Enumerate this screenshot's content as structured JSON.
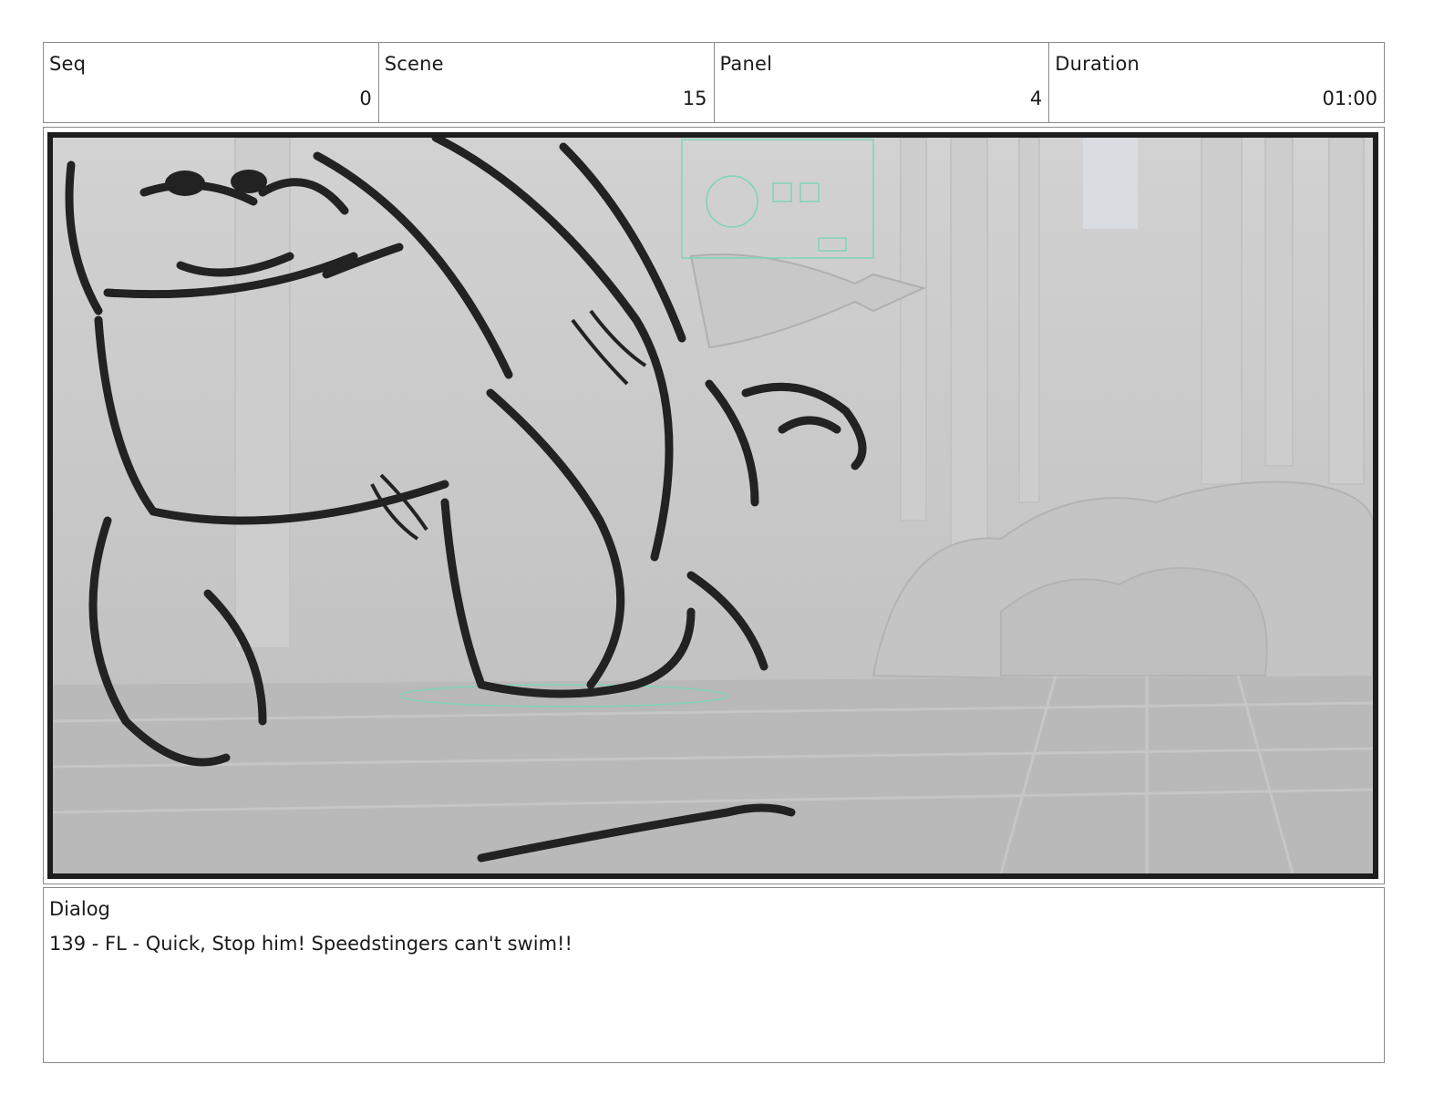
{
  "header": {
    "seq": {
      "label": "Seq",
      "value": "0"
    },
    "scene": {
      "label": "Scene",
      "value": "15"
    },
    "panel": {
      "label": "Panel",
      "value": "4"
    },
    "duration": {
      "label": "Duration",
      "value": "01:00"
    }
  },
  "dialog": {
    "label": "Dialog",
    "text": "139 - FL - Quick, Stop him! Speedstingers can't swim!!"
  }
}
